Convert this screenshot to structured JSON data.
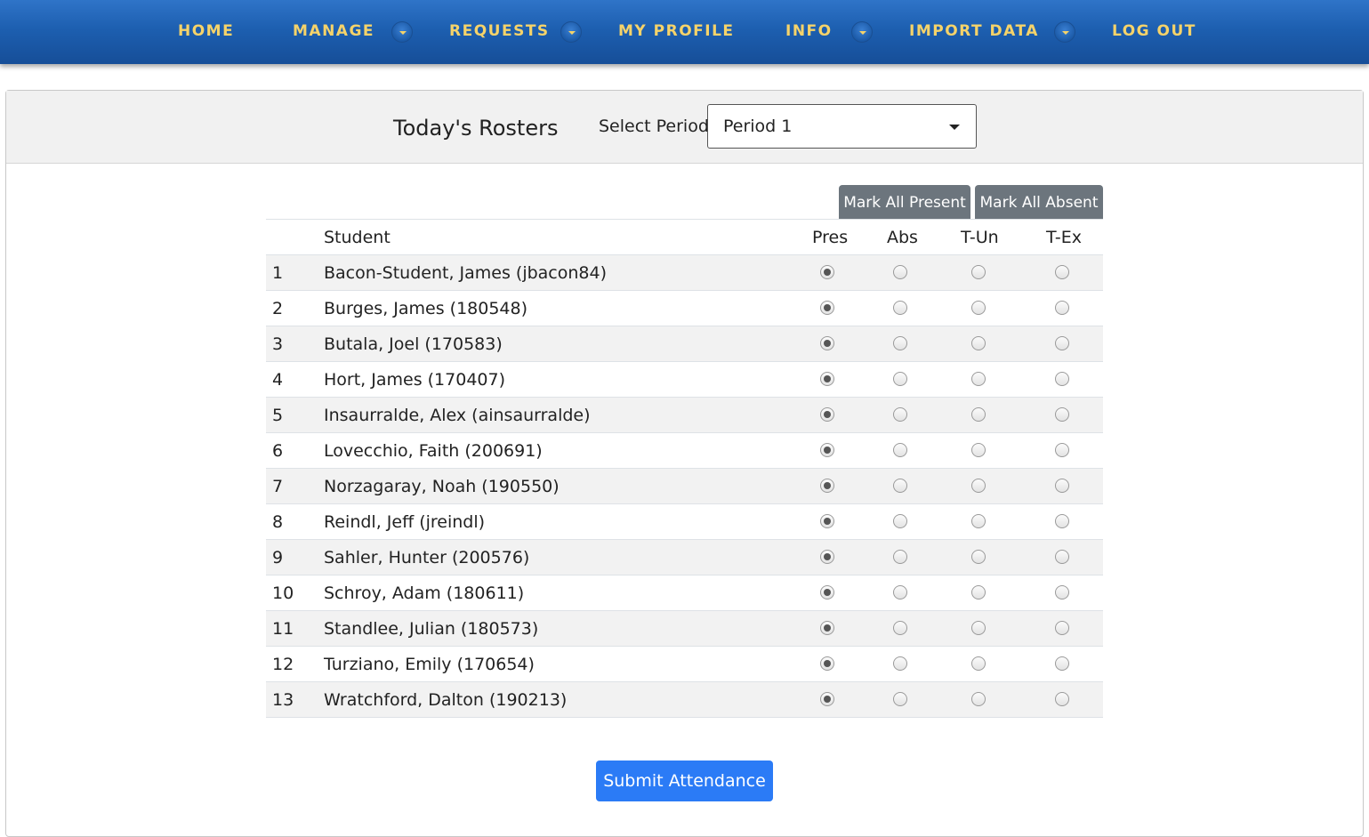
{
  "nav": {
    "home": "HOME",
    "manage": "MANAGE",
    "requests": "REQUESTS",
    "my_profile": "MY PROFILE",
    "info": "INFO",
    "import_data": "IMPORT DATA",
    "log_out": "LOG OUT"
  },
  "header": {
    "title": "Today's Rosters",
    "select_label": "Select Period:",
    "selected_period": "Period 1"
  },
  "actions": {
    "mark_all_present": "Mark All Present",
    "mark_all_absent": "Mark All Absent",
    "submit": "Submit Attendance"
  },
  "table": {
    "columns": [
      "",
      "Student",
      "Pres",
      "Abs",
      "T-Un",
      "T-Ex"
    ],
    "rows": [
      {
        "num": "1",
        "name": "Bacon-Student, James (jbacon84)",
        "status": "Pres"
      },
      {
        "num": "2",
        "name": "Burges, James (180548)",
        "status": "Pres"
      },
      {
        "num": "3",
        "name": "Butala, Joel (170583)",
        "status": "Pres"
      },
      {
        "num": "4",
        "name": "Hort, James (170407)",
        "status": "Pres"
      },
      {
        "num": "5",
        "name": "Insaurralde, Alex (ainsaurralde)",
        "status": "Pres"
      },
      {
        "num": "6",
        "name": "Lovecchio, Faith (200691)",
        "status": "Pres"
      },
      {
        "num": "7",
        "name": "Norzagaray, Noah (190550)",
        "status": "Pres"
      },
      {
        "num": "8",
        "name": "Reindl, Jeff (jreindl)",
        "status": "Pres"
      },
      {
        "num": "9",
        "name": "Sahler, Hunter (200576)",
        "status": "Pres"
      },
      {
        "num": "10",
        "name": "Schroy, Adam (180611)",
        "status": "Pres"
      },
      {
        "num": "11",
        "name": "Standlee, Julian (180573)",
        "status": "Pres"
      },
      {
        "num": "12",
        "name": "Turziano, Emily (170654)",
        "status": "Pres"
      },
      {
        "num": "13",
        "name": "Wratchford, Dalton (190213)",
        "status": "Pres"
      }
    ]
  },
  "colors": {
    "nav_bg": "#1d5fb0",
    "nav_text": "#f5d36a",
    "secondary_button": "#6c757d",
    "primary_button": "#2b7bf6"
  }
}
